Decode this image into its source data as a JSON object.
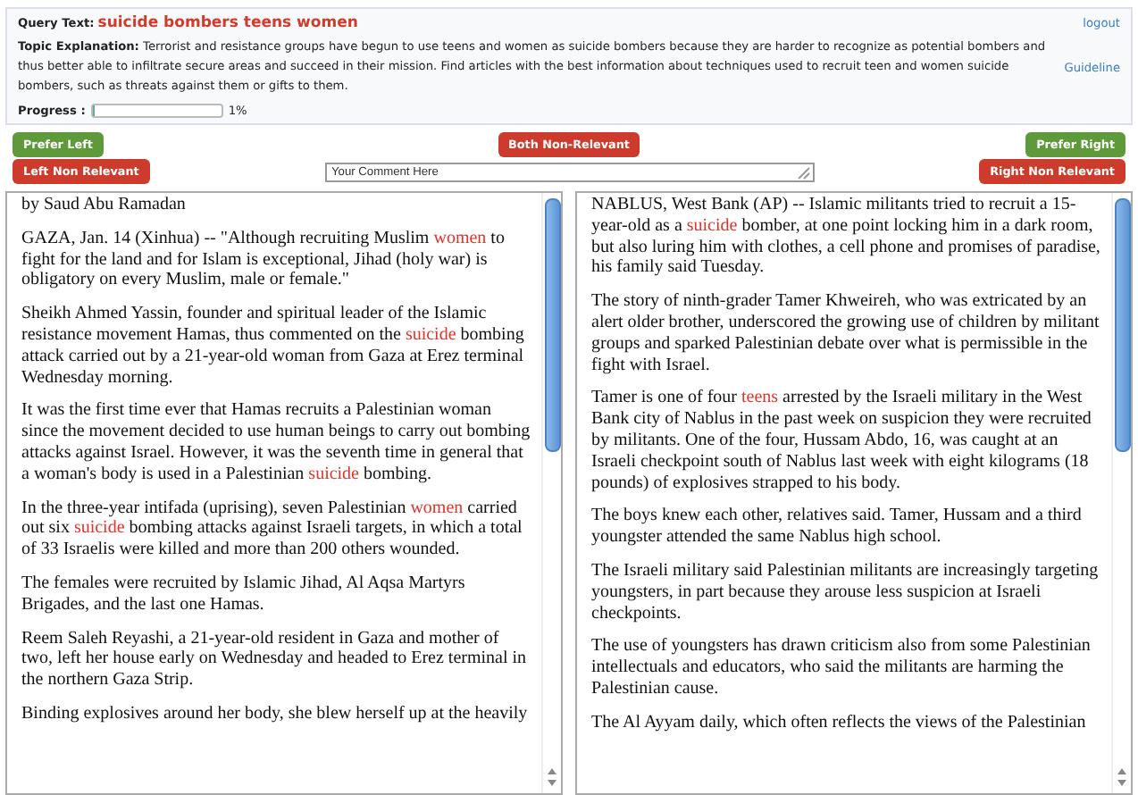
{
  "query": {
    "label": "Query Text:",
    "text": "suicide bombers teens women",
    "logout": "logout"
  },
  "topic": {
    "label": "Topic Explanation:",
    "text": "Terrorist and resistance groups have begun to use teens and women as suicide bombers because they are harder to recognize as potential bombers and thus better able to infiltrate secure areas and succeed in their mission. Find articles with the best information about techniques used to recruit teen and women suicide bombers, such as threats against them or gifts to them.",
    "guideline": "Guideline"
  },
  "progress": {
    "label": "Progress :",
    "level": 0.02,
    "reading": "1%"
  },
  "buttons": [
    {
      "label": "Prefer Left",
      "kind": "prefer"
    },
    {
      "label": "Both Non-Relevant",
      "kind": "reject"
    },
    {
      "label": "Prefer Right",
      "kind": "prefer"
    },
    {
      "label": "Left Non Relevant",
      "kind": "reject"
    },
    {
      "label": "Right Non Relevant",
      "kind": "reject"
    }
  ],
  "comment": {
    "placeholder": "Your Comment Here"
  },
  "articles": [
    {
      "paragraphs": [
        [
          {
            "text": "by Saud Abu Ramadan",
            "highlight": false
          }
        ],
        [
          {
            "text": "GAZA, Jan. 14 (Xinhua) -- \"Although recruiting Muslim ",
            "highlight": false
          },
          {
            "text": "women",
            "highlight": true
          },
          {
            "text": " to fight for the land and for Islam is exceptional, Jihad (holy war) is obligatory on every Muslim, male or female.\"",
            "highlight": false
          }
        ],
        [
          {
            "text": "Sheikh Ahmed Yassin, founder and spiritual leader of the Islamic resistance movement Hamas, thus commented on the ",
            "highlight": false
          },
          {
            "text": "suicide",
            "highlight": true
          },
          {
            "text": " bombing attack carried out by a 21-year-old woman from Gaza at Erez terminal Wednesday morning.",
            "highlight": false
          }
        ],
        [
          {
            "text": "It was the first time ever that Hamas recruits a Palestinian woman since the movement decided to use human beings to carry out bombing attacks against Israel. However, it was the seventh time in general that a woman's body is used in a Palestinian ",
            "highlight": false
          },
          {
            "text": "suicide",
            "highlight": true
          },
          {
            "text": " bombing.",
            "highlight": false
          }
        ],
        [
          {
            "text": "In the three-year intifada (uprising), seven Palestinian ",
            "highlight": false
          },
          {
            "text": "women",
            "highlight": true
          },
          {
            "text": " carried out six ",
            "highlight": false
          },
          {
            "text": "suicide",
            "highlight": true
          },
          {
            "text": " bombing attacks against Israeli targets, in which a total of 33 Israelis were killed and more than 200 others wounded.",
            "highlight": false
          }
        ],
        [
          {
            "text": "The females were recruited by Islamic Jihad, Al Aqsa Martyrs Brigades, and the last one Hamas.",
            "highlight": false
          }
        ],
        [
          {
            "text": "Reem Saleh Reyashi, a 21-year-old resident in Gaza and mother of two, left her house early on Wednesday and headed to Erez terminal in the northern Gaza Strip.",
            "highlight": false
          }
        ],
        [
          {
            "text": "Binding explosives around her body, she blew herself up at the heavily",
            "highlight": false
          }
        ]
      ]
    },
    {
      "paragraphs": [
        [
          {
            "text": "NABLUS, West Bank (AP) -- Islamic militants tried to recruit a 15-year-old as a ",
            "highlight": false
          },
          {
            "text": "suicide",
            "highlight": true
          },
          {
            "text": " bomber, at one point locking him in a dark room, but also luring him with clothes, a cell phone and promises of paradise, his family said Tuesday.",
            "highlight": false
          }
        ],
        [
          {
            "text": "The story of ninth-grader Tamer Khweireh, who was extricated by an alert older brother, underscored the growing use of children by militant groups and sparked Palestinian debate over what is permissible in the fight with Israel.",
            "highlight": false
          }
        ],
        [
          {
            "text": "Tamer is one of four ",
            "highlight": false
          },
          {
            "text": "teens",
            "highlight": true
          },
          {
            "text": " arrested by the Israeli military in the West Bank city of Nablus in the past week on suspicion they were recruited by militants. One of the four, Hussam Abdo, 16, was caught at an Israeli checkpoint south of Nablus last week with eight kilograms (18 pounds) of explosives strapped to his body.",
            "highlight": false
          }
        ],
        [
          {
            "text": "The boys knew each other, relatives said. Tamer, Hussam and a third youngster attended the same Nablus high school.",
            "highlight": false
          }
        ],
        [
          {
            "text": "The Israeli military said Palestinian militants are increasingly targeting youngsters, in part because they arouse less suspicion at Israeli checkpoints.",
            "highlight": false
          }
        ],
        [
          {
            "text": "The use of youngsters has drawn criticism also from some Palestinian intellectuals and educators, who said the militants are harming the Palestinian cause.",
            "highlight": false
          }
        ],
        [
          {
            "text": "The Al Ayyam daily, which often reflects the views of the Palestinian",
            "highlight": false
          }
        ]
      ]
    }
  ]
}
